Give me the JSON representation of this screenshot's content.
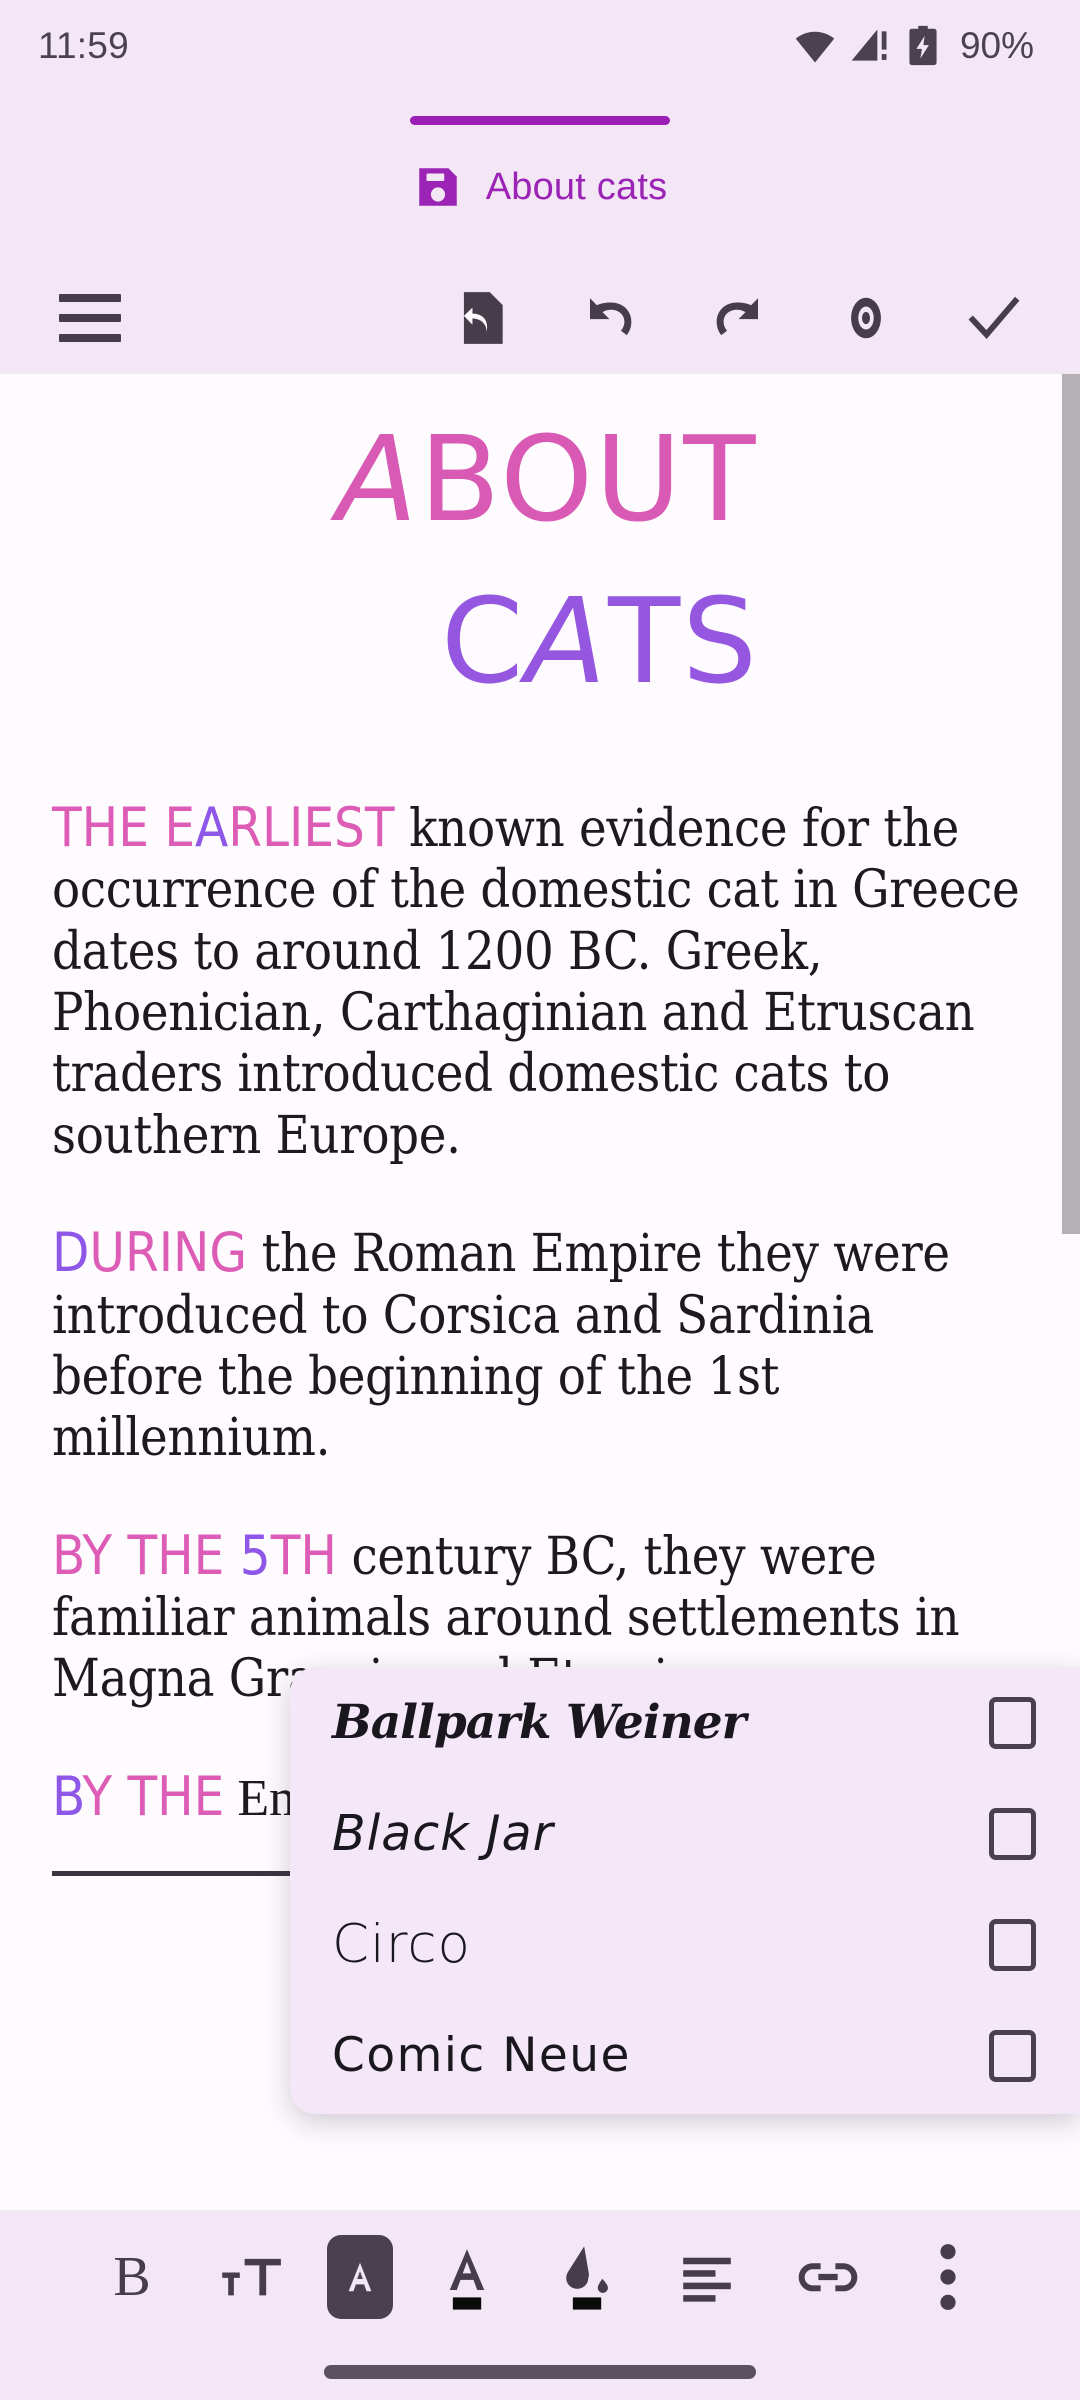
{
  "status_bar": {
    "time": "11:59",
    "battery_percent": "90%",
    "icons": [
      "wifi-icon",
      "cell-signal-alert-icon",
      "battery-charging-icon"
    ]
  },
  "tab": {
    "label": "About cats",
    "icon": "save-floppy-icon",
    "accent_color": "#9c1fb5",
    "label_color": "#9b24b6"
  },
  "action_toolbar": {
    "items": [
      {
        "name": "menu-button",
        "icon": "hamburger-icon"
      },
      {
        "name": "revert-file-button",
        "icon": "file-undo-icon"
      },
      {
        "name": "undo-button",
        "icon": "undo-arrow-icon"
      },
      {
        "name": "redo-button",
        "icon": "redo-arrow-icon"
      },
      {
        "name": "preview-button",
        "icon": "eye-icon"
      },
      {
        "name": "done-button",
        "icon": "checkmark-icon"
      }
    ]
  },
  "document": {
    "title_line1": "ABOUT",
    "title_line2": "CATS",
    "title_line1_color": "#d95ab4",
    "title_line2_color": "#9657e0",
    "paragraphs": [
      {
        "lead_parts": [
          {
            "text": "THE E",
            "color": "pink"
          },
          {
            "text": "A",
            "color": "purple"
          },
          {
            "text": "RLIEST",
            "color": "pink"
          }
        ],
        "body": " known evidence for the occurrence of the domestic cat in Greece dates to around 1200 BC. Greek, Phoenician, Carthaginian and Etruscan traders introduced domestic cats to southern Europe."
      },
      {
        "lead_parts": [
          {
            "text": "D",
            "color": "purple"
          },
          {
            "text": "URING",
            "color": "pink"
          }
        ],
        "body": " the Roman Empire they were introduced to Corsica and Sardinia before the beginning of the 1st millennium."
      },
      {
        "lead_parts": [
          {
            "text": "BY THE ",
            "color": "pink"
          },
          {
            "text": "5",
            "color": "purple"
          },
          {
            "text": "TH",
            "color": "pink"
          }
        ],
        "body": " century BC, they were familiar animals around settlements in Magna Graecia and Etruria."
      },
      {
        "lead_parts": [
          {
            "text": "B",
            "color": "purple"
          },
          {
            "text": "Y THE",
            "color": "pink"
          }
        ],
        "body": " Empire in the domestic c Sea port in"
      }
    ]
  },
  "font_menu": {
    "options": [
      {
        "name": "Ballpark Weiner",
        "checked": false
      },
      {
        "name": "Black Jar",
        "checked": false
      },
      {
        "name": "Circo",
        "checked": false
      },
      {
        "name": "Comic Neue",
        "checked": false
      }
    ]
  },
  "format_toolbar": {
    "items": [
      {
        "name": "bold-button",
        "label": "B",
        "icon": "bold-icon",
        "selected": false
      },
      {
        "name": "text-size-button",
        "label": "",
        "icon": "text-size-icon",
        "selected": false
      },
      {
        "name": "font-family-button",
        "label": "A",
        "icon": "font-family-icon",
        "selected": true
      },
      {
        "name": "text-color-button",
        "label": "A",
        "icon": "text-color-icon",
        "selected": false
      },
      {
        "name": "highlight-color-button",
        "label": "",
        "icon": "fill-bucket-icon",
        "selected": false
      },
      {
        "name": "align-left-button",
        "label": "",
        "icon": "align-left-icon",
        "selected": false
      },
      {
        "name": "link-button",
        "label": "",
        "icon": "link-icon",
        "selected": false
      },
      {
        "name": "more-options-button",
        "label": "",
        "icon": "three-dots-vertical-icon",
        "selected": false
      }
    ]
  },
  "colors": {
    "chrome_background": "#f3e7f6",
    "document_background": "#fdfbfe",
    "icon_color": "#463c4a",
    "accent_purple": "#9c1fb5",
    "accent_pink": "#dd5cb6"
  }
}
